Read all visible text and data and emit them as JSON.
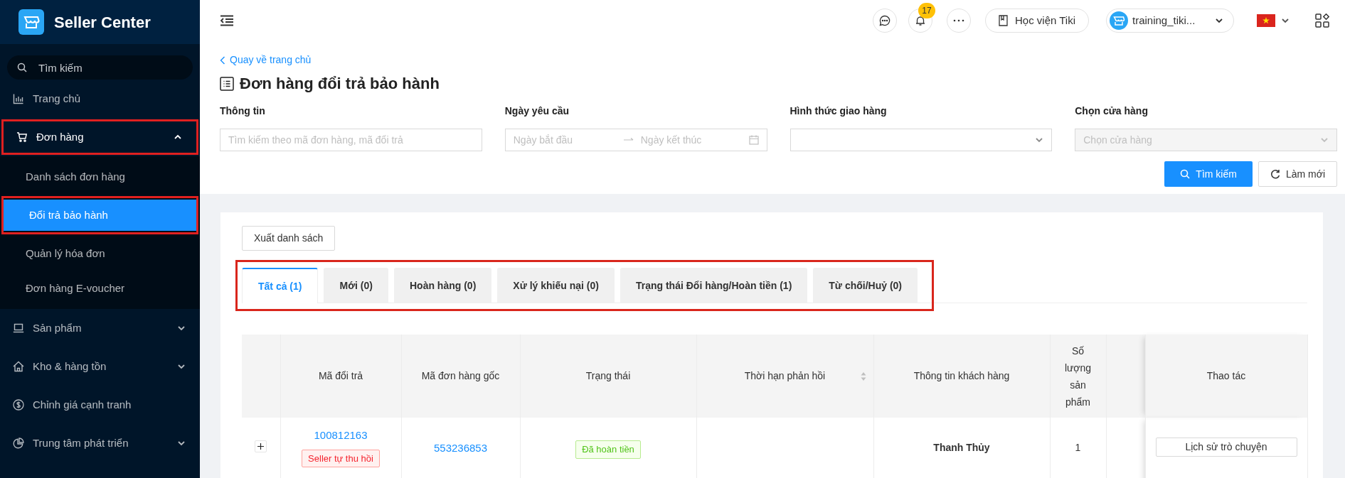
{
  "sidebar": {
    "brand": "Seller Center",
    "search": {
      "placeholder": "Tìm kiếm"
    },
    "items": [
      {
        "label": "Trang chủ",
        "selected": false,
        "highlighted": false
      },
      {
        "label": "Đơn hàng",
        "selected": false,
        "expanded": true,
        "highlighted": true,
        "children": [
          {
            "label": "Danh sách đơn hàng",
            "selected": false,
            "highlighted": false
          },
          {
            "label": "Đổi trả bảo hành",
            "selected": true,
            "highlighted": true
          },
          {
            "label": "Quản lý hóa đơn",
            "selected": false,
            "highlighted": false
          },
          {
            "label": "Đơn hàng E-voucher",
            "selected": false,
            "highlighted": false
          }
        ]
      },
      {
        "label": "Sản phẩm",
        "selected": false,
        "expanded": false,
        "highlighted": false
      },
      {
        "label": "Kho & hàng tồn",
        "selected": false,
        "expanded": false,
        "highlighted": false
      },
      {
        "label": "Chỉnh giá cạnh tranh",
        "selected": false,
        "highlighted": false
      },
      {
        "label": "Trung tâm phát triển",
        "selected": false,
        "expanded": false,
        "highlighted": false
      }
    ]
  },
  "header": {
    "notifications": "17",
    "academy_button": "Học viện Tiki",
    "account": "training_tiki..."
  },
  "page": {
    "back_link": "Quay về trang chủ",
    "title": "Đơn hàng đổi trả bảo hành",
    "filters": [
      {
        "kind": "text",
        "label": "Thông tin",
        "placeholder": "Tìm kiếm theo mã đơn hàng, mã đổi trả"
      },
      {
        "kind": "daterange",
        "label": "Ngày yêu cầu",
        "start_placeholder": "Ngày bắt đầu",
        "end_placeholder": "Ngày kết thúc"
      },
      {
        "kind": "select",
        "label": "Hình thức giao hàng",
        "disabled": false
      },
      {
        "kind": "select",
        "label": "Chọn cửa hàng",
        "placeholder": "Chọn cửa hàng",
        "disabled": true
      }
    ],
    "search_button": "Tìm kiếm",
    "reset_button": "Làm mới",
    "export_button": "Xuất danh sách",
    "tabs_highlighted": true,
    "tabs": [
      {
        "label": "Tất cả (1)",
        "selected": true
      },
      {
        "label": "Mới (0)",
        "selected": false
      },
      {
        "label": "Hoàn hàng (0)",
        "selected": false
      },
      {
        "label": "Xử lý khiếu nại (0)",
        "selected": false
      },
      {
        "label": "Trạng thái Đổi hàng/Hoàn tiền (1)",
        "selected": false
      },
      {
        "label": "Từ chối/Huỷ (0)",
        "selected": false
      }
    ],
    "table": {
      "columns": [
        {
          "kind": "expand"
        },
        {
          "kind": "text",
          "label": "Mã đổi trả"
        },
        {
          "kind": "text",
          "label": "Mã đơn hàng gốc"
        },
        {
          "kind": "text",
          "label": "Trạng thái"
        },
        {
          "kind": "sortable",
          "label": "Thời hạn phản hồi"
        },
        {
          "kind": "text",
          "label": "Thông tin khách hàng"
        },
        {
          "kind": "text",
          "label": "Số lượng sản phẩm"
        },
        {
          "kind": "blank"
        },
        {
          "kind": "action",
          "label": "Thao tác"
        }
      ],
      "rows": [
        {
          "expanded": false,
          "return_code": "100812163",
          "return_tag": "Seller tự thu hồi",
          "order_code": "553236853",
          "status": "Đã hoàn tiền",
          "customer": "Thanh Thủy",
          "quantity": "1",
          "action": "Lịch sử trò chuyện"
        }
      ]
    }
  }
}
